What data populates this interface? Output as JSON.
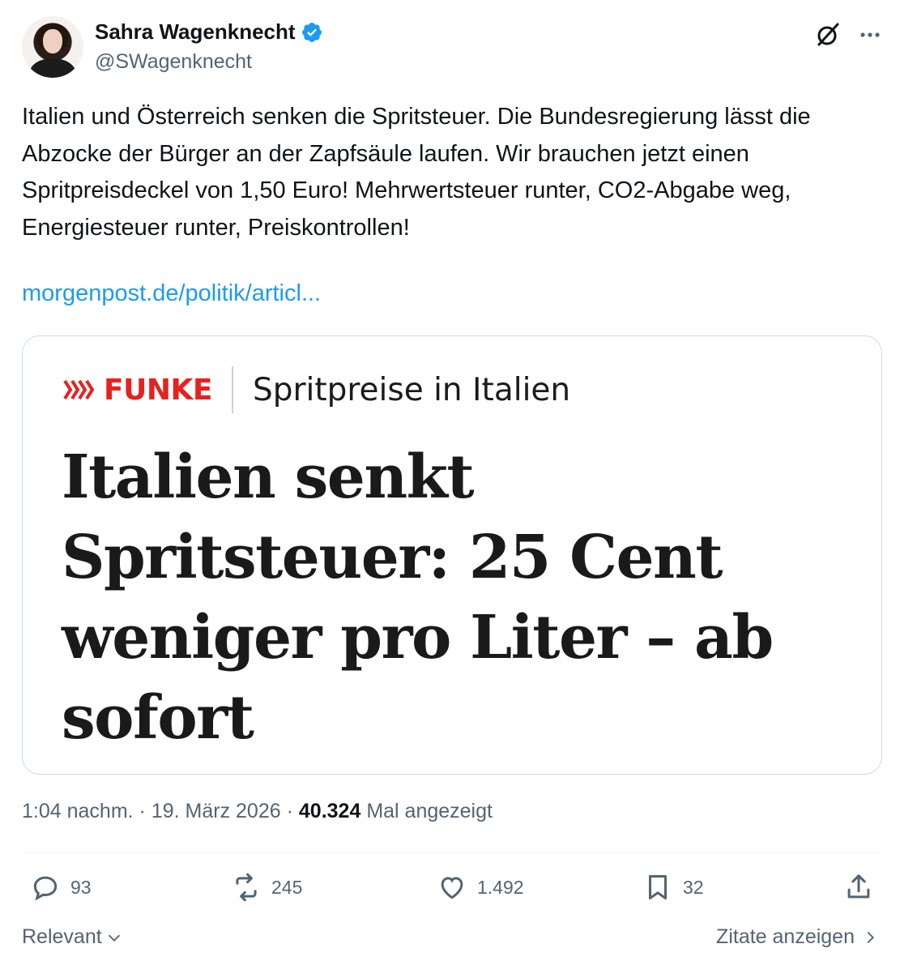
{
  "author": {
    "name": "Sahra Wagenknecht",
    "handle": "@SWagenknecht"
  },
  "tweet": {
    "text": "Italien und Österreich senken die Spritsteuer. Die Bundesregierung lässt die Abzocke der Bürger an der Zapfsäule laufen. Wir brauchen jetzt einen Spritpreisdeckel von 1,50 Euro! Mehrwertsteuer runter, CO2-Abgabe weg, Energiesteuer runter, Preiskontrollen!",
    "link": "morgenpost.de/politik/articl..."
  },
  "card": {
    "brand": "FUNKE",
    "section": "Spritpreise in Italien",
    "headline": "Italien senkt Spritsteuer: 25 Cent weniger pro Liter – ab sofort"
  },
  "meta": {
    "time": "1:04 nachm.",
    "date": "19. März 2026",
    "views_count": "40.324",
    "views_label": "Mal angezeigt"
  },
  "actions": {
    "replies": "93",
    "reposts": "245",
    "likes": "1.492",
    "bookmarks": "32"
  },
  "footer": {
    "sort_label": "Relevant",
    "quotes_label": "Zitate anzeigen"
  },
  "icons": {
    "verified": "verified-badge-icon",
    "grok": "grok-icon",
    "more": "more-icon",
    "reply": "reply-icon",
    "repost": "repost-icon",
    "like": "like-icon",
    "bookmark": "bookmark-icon",
    "share": "share-icon"
  },
  "colors": {
    "link": "#1d9bf0",
    "verified": "#1d9bf0",
    "muted": "#536471",
    "brand_red": "#e42320"
  }
}
